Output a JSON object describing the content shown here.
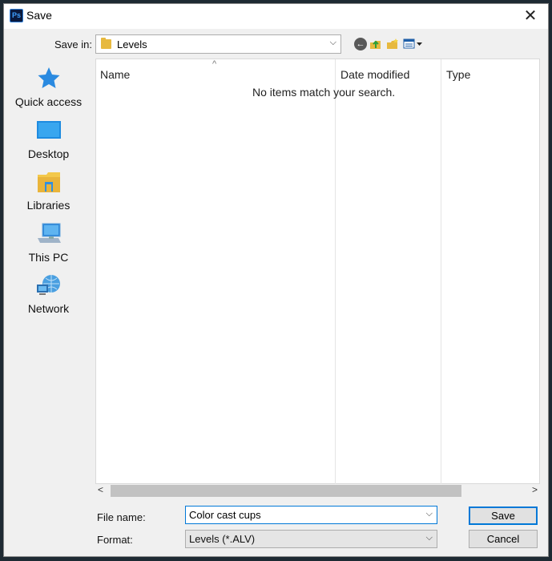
{
  "window": {
    "title": "Save",
    "app_icon": "Ps",
    "close_glyph": "✕"
  },
  "toolbar": {
    "save_in_label": "Save in:",
    "save_in_value": "Levels",
    "dropdown_glyph": "⌵",
    "back_icon": "back-icon",
    "up_icon": "up-folder-icon",
    "new_folder_icon": "new-folder-icon",
    "views_icon": "view-menu-icon"
  },
  "places": [
    {
      "label": "Quick access",
      "icon": "star-icon"
    },
    {
      "label": "Desktop",
      "icon": "desktop-icon"
    },
    {
      "label": "Libraries",
      "icon": "libraries-icon"
    },
    {
      "label": "This PC",
      "icon": "computer-icon"
    },
    {
      "label": "Network",
      "icon": "network-icon"
    }
  ],
  "file_list": {
    "columns": [
      "Name",
      "Date modified",
      "Type"
    ],
    "sort_glyph": "^",
    "empty_message": "No items match your search."
  },
  "scrollbar": {
    "left_glyph": "<",
    "right_glyph": ">"
  },
  "form": {
    "file_name_label": "File name:",
    "file_name_value": "Color cast cups",
    "format_label": "Format:",
    "format_value": "Levels (*.ALV)",
    "dropdown_glyph": "⌵"
  },
  "buttons": {
    "save": "Save",
    "cancel": "Cancel"
  },
  "colors": {
    "accent": "#0078d7",
    "folder": "#e7b93f",
    "ps_icon_bg": "#0a1a3e"
  }
}
